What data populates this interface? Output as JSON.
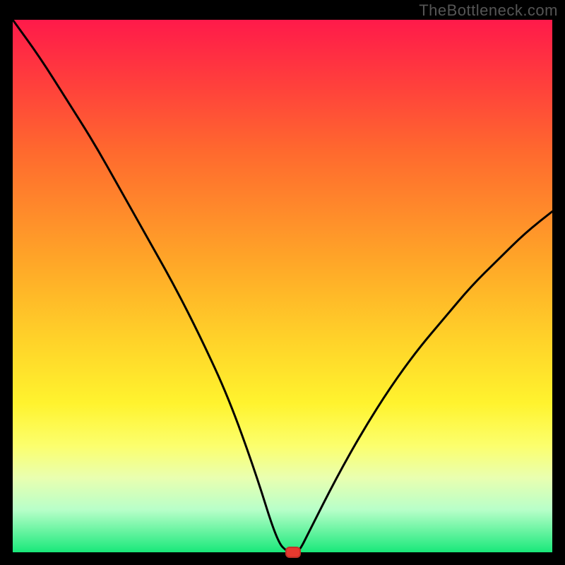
{
  "watermark": "TheBottleneck.com",
  "chart_data": {
    "type": "line",
    "title": "",
    "xlabel": "",
    "ylabel": "",
    "xlim": [
      0,
      100
    ],
    "ylim": [
      0,
      100
    ],
    "x": [
      0,
      5,
      10,
      15,
      20,
      25,
      30,
      35,
      40,
      45,
      49,
      51,
      52,
      53,
      55,
      60,
      65,
      70,
      75,
      80,
      85,
      90,
      95,
      100
    ],
    "values": [
      100,
      93,
      85,
      77,
      68,
      59,
      50,
      40,
      29,
      15,
      2,
      0,
      0,
      0,
      4,
      14,
      23,
      31,
      38,
      44,
      50,
      55,
      60,
      64
    ],
    "marker": {
      "x": 52,
      "y": 0
    },
    "colors": {
      "top": "#ff1a4a",
      "bottom": "#19e87a",
      "curve": "#000000",
      "marker": "#e6392f"
    }
  }
}
